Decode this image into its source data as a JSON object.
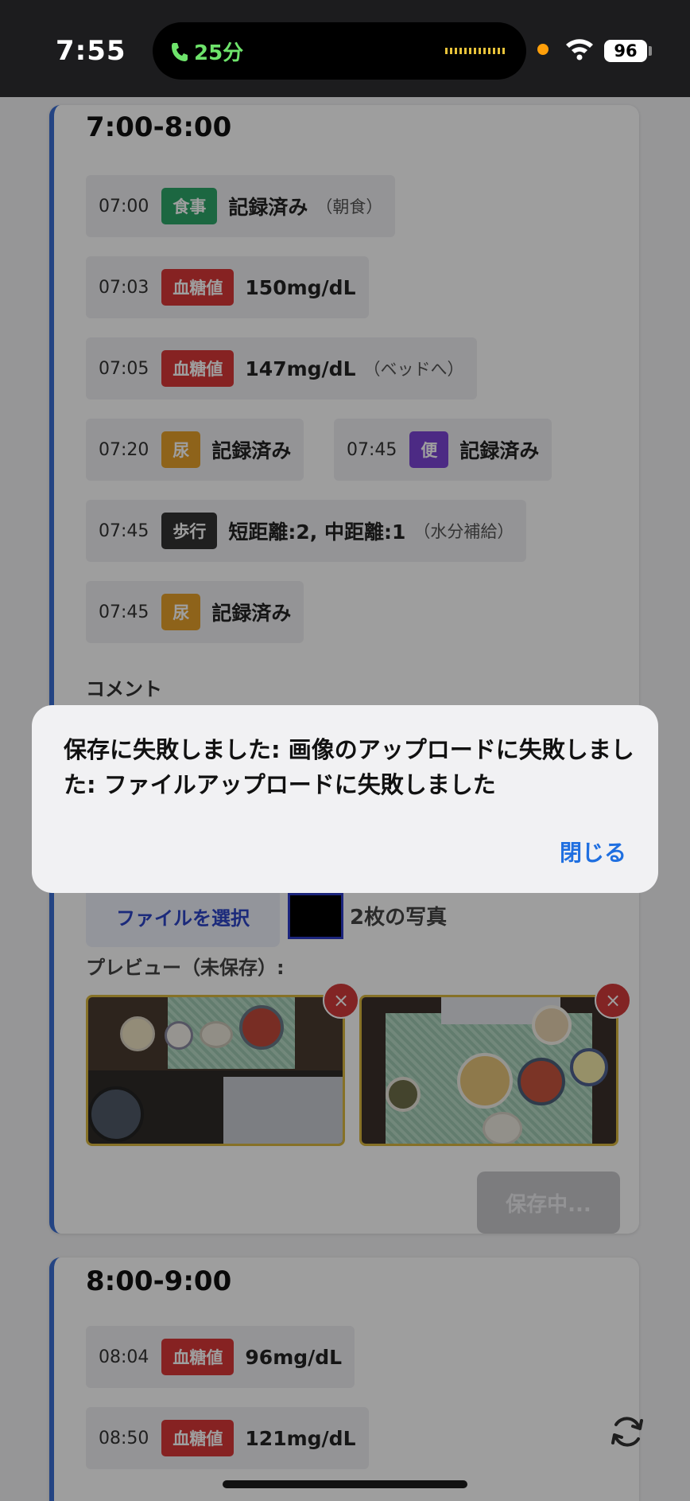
{
  "status_bar": {
    "time": "7:55",
    "call_label": "25分",
    "battery": "96"
  },
  "timeline": [
    {
      "slot": "7:00-8:00",
      "entries": [
        {
          "time": "07:00",
          "badge": "食事",
          "text": "記録済み",
          "note": "（朝食）"
        },
        {
          "time": "07:03",
          "badge": "血糖値",
          "text": "150mg/dL",
          "note": ""
        },
        {
          "time": "07:05",
          "badge": "血糖値",
          "text": "147mg/dL",
          "note": "（ベッドへ）"
        },
        {
          "time": "07:20",
          "badge": "尿",
          "text": "記録済み",
          "note": ""
        },
        {
          "time": "07:45",
          "badge": "便",
          "text": "記録済み",
          "note": ""
        },
        {
          "time": "07:45",
          "badge": "歩行",
          "text": "短距離:2, 中距離:1",
          "note": "（水分補給）"
        },
        {
          "time": "07:45",
          "badge": "尿",
          "text": "記録済み",
          "note": ""
        }
      ],
      "comment_label": "コメント",
      "file_button": "ファイルを選択",
      "photo_count": "2枚の写真",
      "preview_label": "プレビュー（未保存）:",
      "remove_symbol": "×",
      "save_button": "保存中..."
    },
    {
      "slot": "8:00-9:00",
      "entries": [
        {
          "time": "08:04",
          "badge": "血糖値",
          "text": "96mg/dL",
          "note": ""
        },
        {
          "time": "08:50",
          "badge": "血糖値",
          "text": "121mg/dL",
          "note": ""
        }
      ]
    }
  ],
  "dialog": {
    "message": "保存に失敗しました: 画像のアップロードに失敗しました: ファイルアップロードに失敗しました",
    "close_label": "閉じる"
  },
  "icons": {
    "phone": "phone-icon",
    "wifi": "wifi-icon",
    "refresh": "refresh-icon"
  },
  "colors": {
    "accent": "#3b6fd4",
    "meal": "#2ea66a",
    "glucose": "#d93838",
    "urine": "#e6a12a",
    "stool": "#7b44d6",
    "walk": "#333333",
    "dialog_action": "#1f6fe0"
  }
}
